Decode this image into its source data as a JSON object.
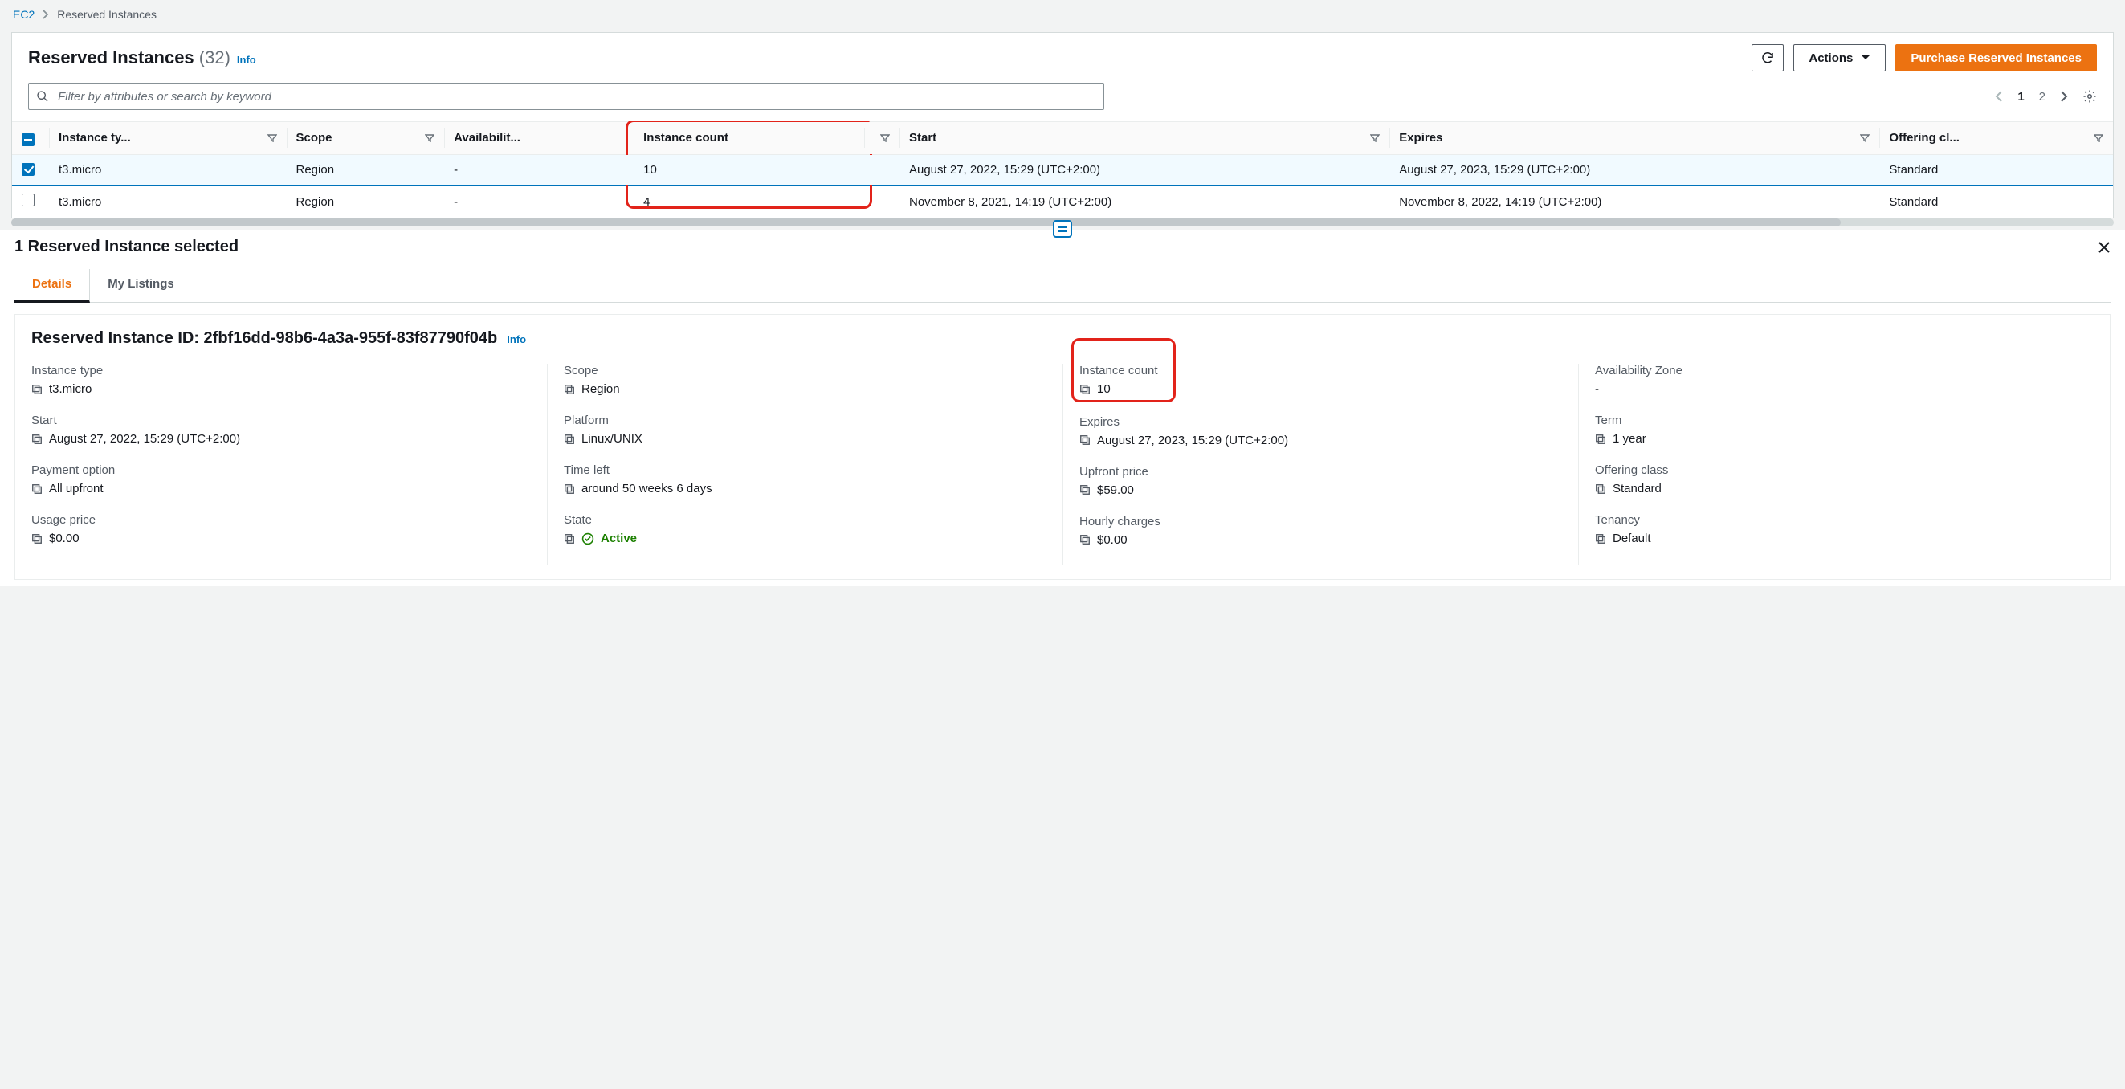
{
  "breadcrumb": {
    "root": "EC2",
    "current": "Reserved Instances"
  },
  "header": {
    "title": "Reserved Instances",
    "count": "(32)",
    "info": "Info",
    "actions_label": "Actions",
    "purchase_label": "Purchase Reserved Instances"
  },
  "filter": {
    "placeholder": "Filter by attributes or search by keyword"
  },
  "paging": {
    "page1": "1",
    "page2": "2"
  },
  "columns": {
    "instance_type": "Instance ty...",
    "scope": "Scope",
    "availability": "Availabilit...",
    "instance_count": "Instance count",
    "start": "Start",
    "expires": "Expires",
    "offering_class": "Offering cl..."
  },
  "rows": [
    {
      "instance_type": "t3.micro",
      "scope": "Region",
      "availability": "-",
      "instance_count": "10",
      "start": "August 27, 2022, 15:29 (UTC+2:00)",
      "expires": "August 27, 2023, 15:29 (UTC+2:00)",
      "offering_class": "Standard",
      "selected": true
    },
    {
      "instance_type": "t3.micro",
      "scope": "Region",
      "availability": "-",
      "instance_count": "4",
      "start": "November 8, 2021, 14:19 (UTC+2:00)",
      "expires": "November 8, 2022, 14:19 (UTC+2:00)",
      "offering_class": "Standard",
      "selected": false
    }
  ],
  "detail": {
    "heading": "1 Reserved Instance selected",
    "tabs": {
      "details": "Details",
      "listings": "My Listings"
    },
    "title_prefix": "Reserved Instance ID: ",
    "id": "2fbf16dd-98b6-4a3a-955f-83f87790f04b",
    "info": "Info",
    "fields": {
      "instance_type": {
        "label": "Instance type",
        "value": "t3.micro"
      },
      "scope": {
        "label": "Scope",
        "value": "Region"
      },
      "instance_count": {
        "label": "Instance count",
        "value": "10"
      },
      "availability": {
        "label": "Availability Zone",
        "value": "-"
      },
      "start": {
        "label": "Start",
        "value": "August 27, 2022, 15:29 (UTC+2:00)"
      },
      "platform": {
        "label": "Platform",
        "value": "Linux/UNIX"
      },
      "expires": {
        "label": "Expires",
        "value": "August 27, 2023, 15:29 (UTC+2:00)"
      },
      "term": {
        "label": "Term",
        "value": "1 year"
      },
      "payment_option": {
        "label": "Payment option",
        "value": "All upfront"
      },
      "time_left": {
        "label": "Time left",
        "value": "around 50 weeks 6 days"
      },
      "upfront_price": {
        "label": "Upfront price",
        "value": "$59.00"
      },
      "offering_class": {
        "label": "Offering class",
        "value": "Standard"
      },
      "usage_price": {
        "label": "Usage price",
        "value": "$0.00"
      },
      "state": {
        "label": "State",
        "value": "Active"
      },
      "hourly_charges": {
        "label": "Hourly charges",
        "value": "$0.00"
      },
      "tenancy": {
        "label": "Tenancy",
        "value": "Default"
      }
    }
  }
}
